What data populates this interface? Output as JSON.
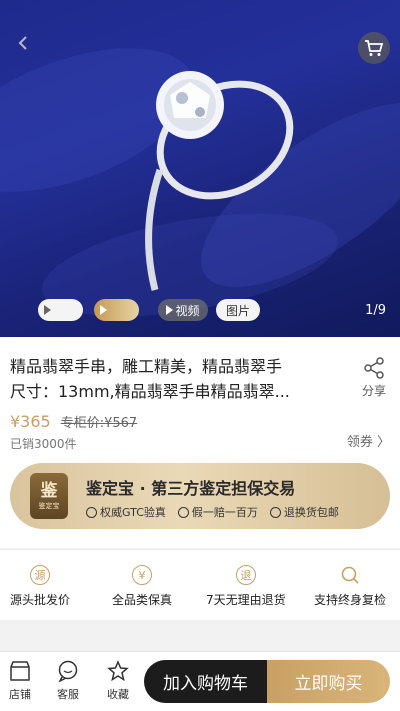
{
  "gallery": {
    "pill_video": "视频",
    "pill_photo": "图片",
    "counter": "1/9"
  },
  "product": {
    "title_line1": "精品翡翠手串，雕工精美，精品翡翠手",
    "title_line2": "尺寸：13mm,精品翡翠手串精品翡翠...",
    "share_label": "分享",
    "price": "¥365",
    "original_price": "专柜价:¥567",
    "sold": "已销3000件",
    "coupon": "领券 〉"
  },
  "banner": {
    "badge_big": "鉴",
    "badge_small": "鉴定宝",
    "title": "鉴定宝 · 第三方鉴定担保交易",
    "feature_1": "权威GTC验真",
    "feature_2": "假一赔一百万",
    "feature_3": "退换货包邮"
  },
  "services": [
    {
      "icon_text": "源",
      "label": "源头批发价"
    },
    {
      "icon_text": "¥",
      "label": "全品类保真"
    },
    {
      "icon_text": "退",
      "label": "7天无理由退货"
    },
    {
      "icon_text": "",
      "label": "支持终身复检"
    }
  ],
  "bottom_bar": {
    "store": "店铺",
    "service": "客服",
    "favorite": "收藏",
    "add_to_cart": "加入购物车",
    "buy_now": "立即购买"
  },
  "colors": {
    "accent_gold": "#c9a063",
    "dark": "#1c1c1c",
    "hero_blue": "#24309a"
  },
  "icons": [
    "back-arrow-icon",
    "cart-icon",
    "play-icon",
    "share-icon",
    "store-icon",
    "chat-icon",
    "star-icon",
    "search-icon",
    "shield-icon",
    "truck-icon"
  ]
}
